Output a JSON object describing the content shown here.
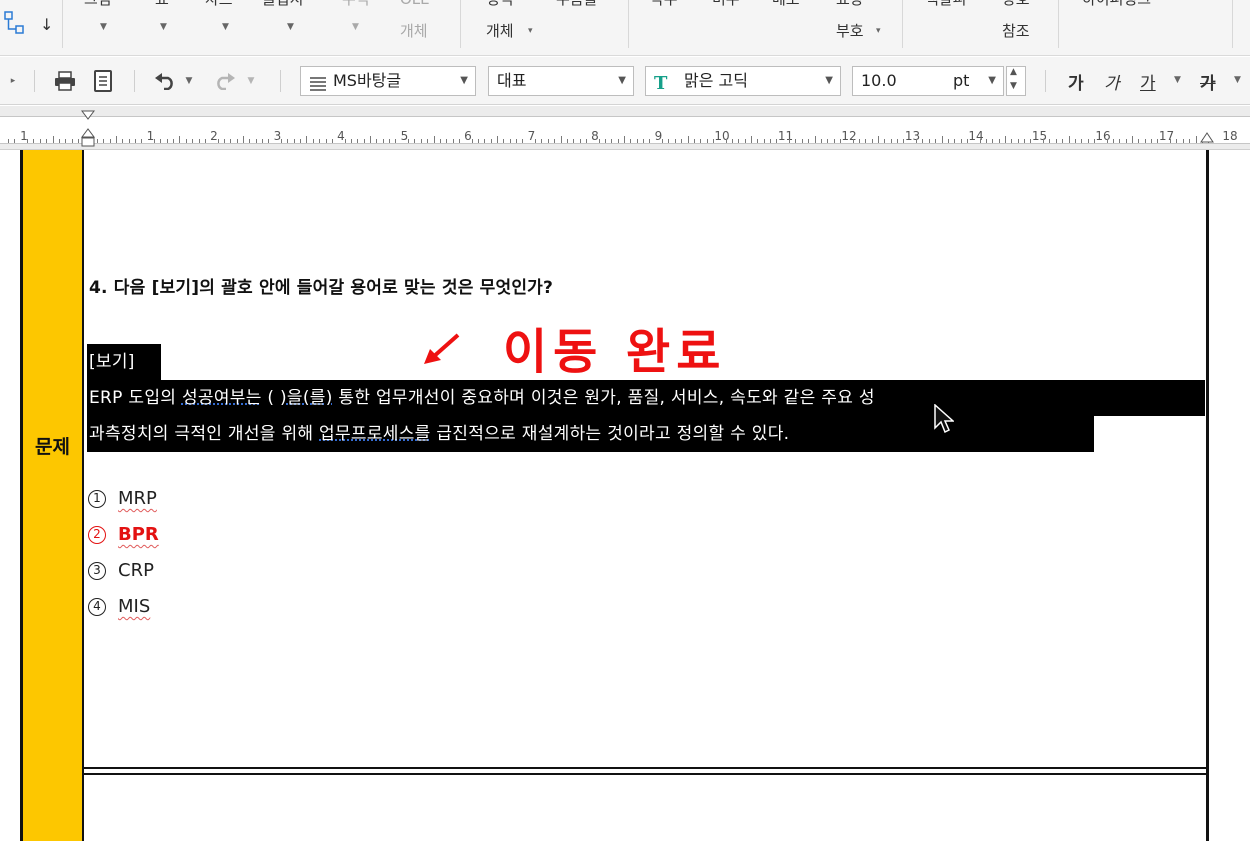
{
  "ribbon": {
    "items": [
      "그림",
      "표",
      "차트",
      "클립지",
      "수식",
      "OLE",
      "개체",
      "정식",
      "개체",
      "누름틀",
      "각주",
      "미주",
      "메모",
      "표상",
      "부호",
      "책갈피",
      "상호",
      "참조",
      "하이퍼링크"
    ]
  },
  "toolbar": {
    "style_combo": "MS바탕글",
    "lang_combo": "대표",
    "font_combo": "맑은 고딕",
    "size_value": "10.0",
    "size_unit": "pt",
    "bold_label": "가",
    "italic_label": "가",
    "underline_label": "가",
    "strike_label": "가"
  },
  "ruler": {
    "labels": [
      "1",
      "1",
      "2",
      "3",
      "4",
      "5",
      "6",
      "7",
      "8",
      "9",
      "10",
      "11",
      "12",
      "13",
      "14",
      "15",
      "16",
      "17",
      "18"
    ]
  },
  "document": {
    "side_label": "문제",
    "question": "4. 다음 [보기]의 괄호 안에 들어갈 용어로 맞는 것은 무엇인가?",
    "annotation": "이동 완료",
    "box_title": "[보기]",
    "box_line1_a": "ERP 도입의 ",
    "box_line1_b": "성공여부는",
    "box_line1_c": " ( )",
    "box_line1_d": "을(를)",
    "box_line1_e": " 통한 업무개선이 중요하며 이것은 원가, 품질, 서비스, 속도와 같은 주요 성",
    "box_line2_a": "과측정치의 극적인 개선을 위해 ",
    "box_line2_b": "업무프로세스를",
    "box_line2_c": " 급진적으로 재설계하는 것이라고 정의할 수 있다.",
    "options": [
      {
        "num": "1",
        "text": "MRP"
      },
      {
        "num": "2",
        "text": "BPR"
      },
      {
        "num": "3",
        "text": "CRP"
      },
      {
        "num": "4",
        "text": "MIS"
      }
    ]
  },
  "colors": {
    "side_column": "#fdc700",
    "annotation": "#ee1111",
    "correct_option": "#e31212",
    "selection": "#000000"
  }
}
